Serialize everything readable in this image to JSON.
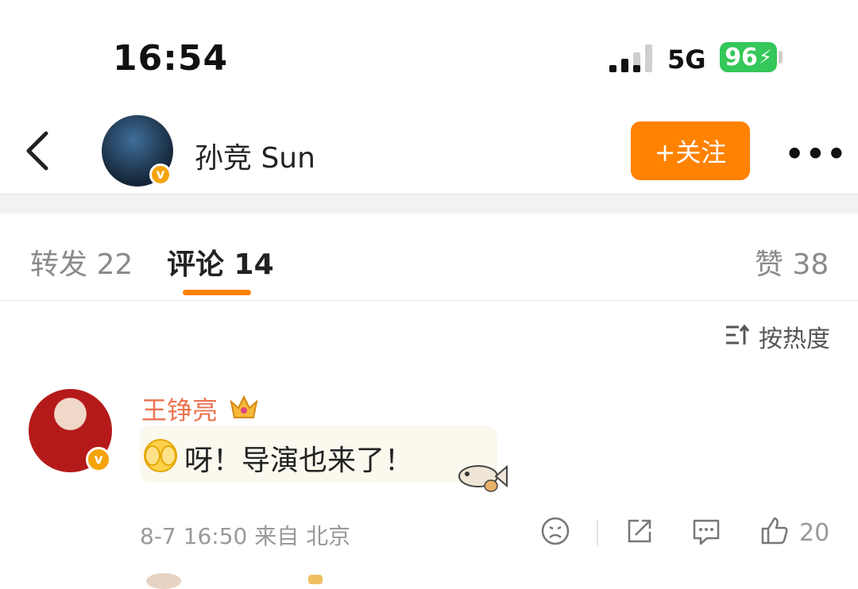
{
  "status_bar": {
    "time": "16:54",
    "network": "5G",
    "battery": "96"
  },
  "header": {
    "author_name": "孙竞 Sun",
    "follow_label": "+关注",
    "more_label": "•••"
  },
  "tabs": [
    {
      "label": "转发 22"
    },
    {
      "label": "评论 14",
      "active": true
    },
    {
      "label": "赞 38"
    }
  ],
  "sort": {
    "label": "按热度"
  },
  "comment": {
    "user": "王铮亮",
    "text": "呀！导演也来了！",
    "date": "8-7 16:50",
    "location": "来自 北京",
    "likes": "20"
  },
  "colors": {
    "accent": "#ff8200",
    "username": "#eb7350",
    "verified": "#f5a30b",
    "battery": "#34c759"
  },
  "icons": [
    "back-icon",
    "verified-icon",
    "more-icon",
    "sort-icon",
    "crown-icon",
    "cover-face-emoji",
    "fish-sticker",
    "dislike-icon",
    "share-icon",
    "reply-icon",
    "like-icon"
  ]
}
